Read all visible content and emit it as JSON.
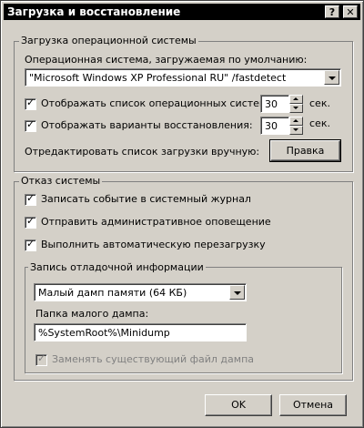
{
  "window": {
    "title": "Загрузка и восстановление",
    "help_button": "?",
    "close_button": "✕"
  },
  "boot": {
    "group_label": "Загрузка операционной системы",
    "default_os_label": "Операционная система, загружаемая по умолчанию:",
    "default_os_value": "\"Microsoft Windows XP Professional RU\" /fastdetect",
    "show_os_list_label": "Отображать список операционных систем:",
    "show_os_list_checked": true,
    "show_os_list_seconds": "30",
    "show_recovery_label": "Отображать варианты восстановления:",
    "show_recovery_checked": true,
    "show_recovery_seconds": "30",
    "seconds_unit": "сек.",
    "edit_manually_label": "Отредактировать список загрузки вручную:",
    "edit_button": "Правка"
  },
  "failure": {
    "group_label": "Отказ системы",
    "write_event_label": "Записать событие в системный журнал",
    "write_event_checked": true,
    "send_alert_label": "Отправить административное оповещение",
    "send_alert_checked": true,
    "auto_restart_label": "Выполнить автоматическую перезагрузку",
    "auto_restart_checked": true,
    "debug": {
      "group_label": "Запись отладочной информации",
      "dump_type_value": "Малый дамп памяти (64 КБ)",
      "dump_folder_label": "Папка малого дампа:",
      "dump_folder_value": "%SystemRoot%\\Minidump",
      "overwrite_label": "Заменять существующий файл дампа",
      "overwrite_checked": true,
      "overwrite_disabled": true
    }
  },
  "footer": {
    "ok_button": "OK",
    "cancel_button": "Отмена"
  }
}
